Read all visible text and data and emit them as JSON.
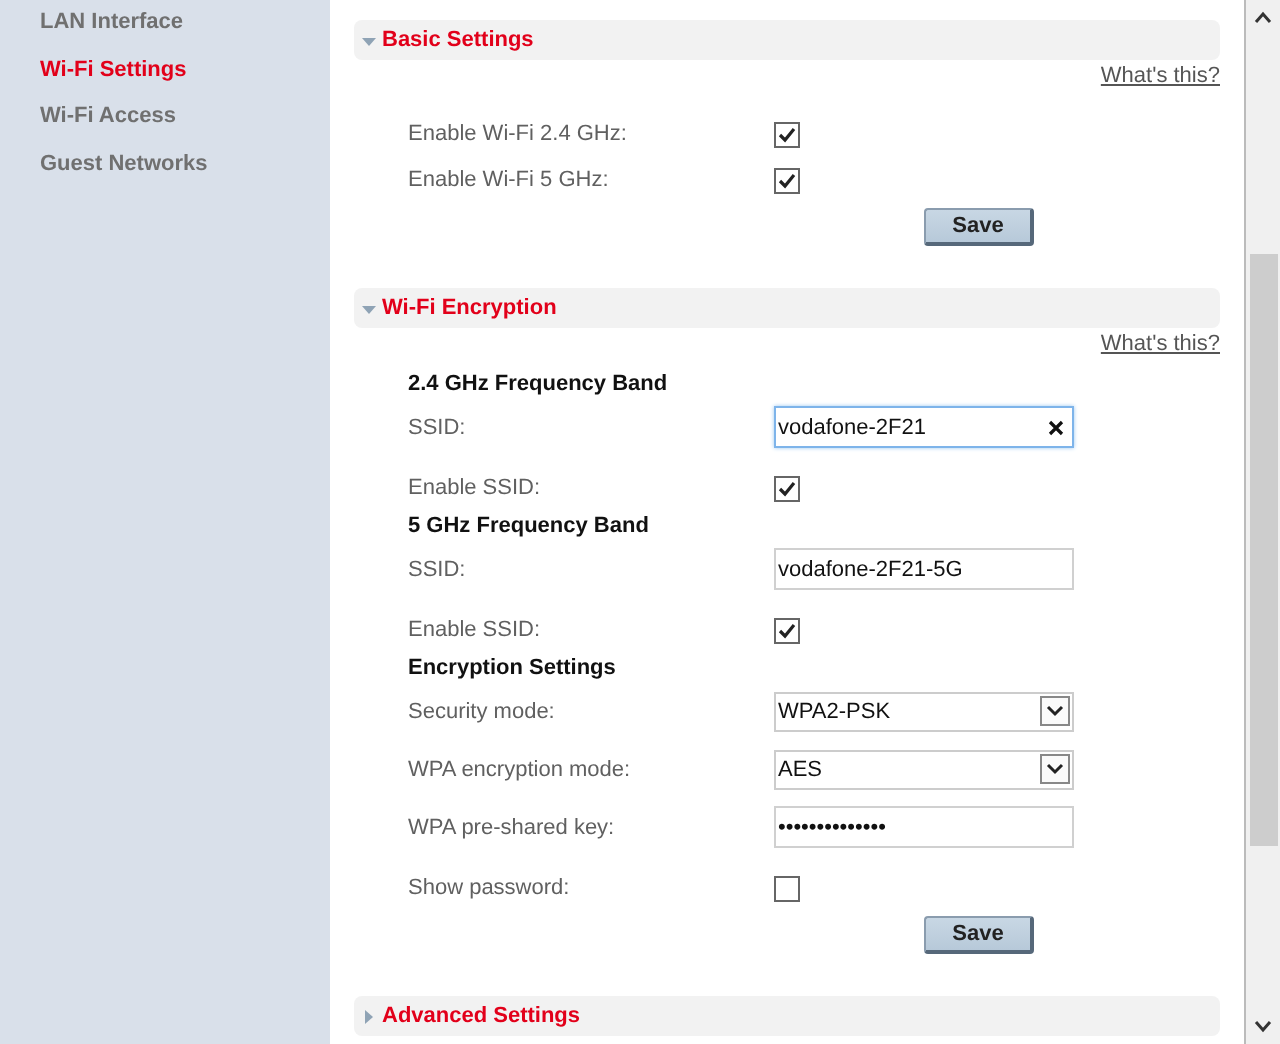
{
  "sidebar": {
    "items": [
      {
        "label": "LAN Interface",
        "selected": false
      },
      {
        "label": "Wi-Fi Settings",
        "selected": true
      },
      {
        "label": "Wi-Fi Access",
        "selected": false
      },
      {
        "label": "Guest Networks",
        "selected": false
      }
    ]
  },
  "sections": [
    {
      "title": "Basic Settings",
      "expanded": true,
      "help_link": "What's this?",
      "rows": [
        {
          "kind": "checkbox",
          "label": "Enable Wi-Fi 2.4 GHz:",
          "checked": true
        },
        {
          "kind": "checkbox",
          "label": "Enable Wi-Fi 5 GHz:",
          "checked": true
        },
        {
          "kind": "button",
          "label": "Save"
        }
      ]
    },
    {
      "title": "Wi-Fi Encryption",
      "expanded": true,
      "help_link": "What's this?",
      "rows": [
        {
          "kind": "heading",
          "label": "2.4 GHz Frequency Band"
        },
        {
          "kind": "text",
          "label": "SSID:",
          "value": "vodafone-2F21",
          "focused": true
        },
        {
          "kind": "checkbox",
          "label": "Enable SSID:",
          "checked": true
        },
        {
          "kind": "heading",
          "label": "5 GHz Frequency Band"
        },
        {
          "kind": "text",
          "label": "SSID:",
          "value": "vodafone-2F21-5G",
          "focused": false
        },
        {
          "kind": "checkbox",
          "label": "Enable SSID:",
          "checked": true
        },
        {
          "kind": "heading",
          "label": "Encryption Settings"
        },
        {
          "kind": "select",
          "label": "Security mode:",
          "value": "WPA2-PSK"
        },
        {
          "kind": "select",
          "label": "WPA encryption mode:",
          "value": "AES"
        },
        {
          "kind": "password",
          "label": "WPA pre-shared key:",
          "value": "••••••••••••••"
        },
        {
          "kind": "checkbox",
          "label": "Show password:",
          "checked": false
        },
        {
          "kind": "button",
          "label": "Save"
        }
      ]
    },
    {
      "title": "Advanced Settings",
      "expanded": false
    }
  ]
}
